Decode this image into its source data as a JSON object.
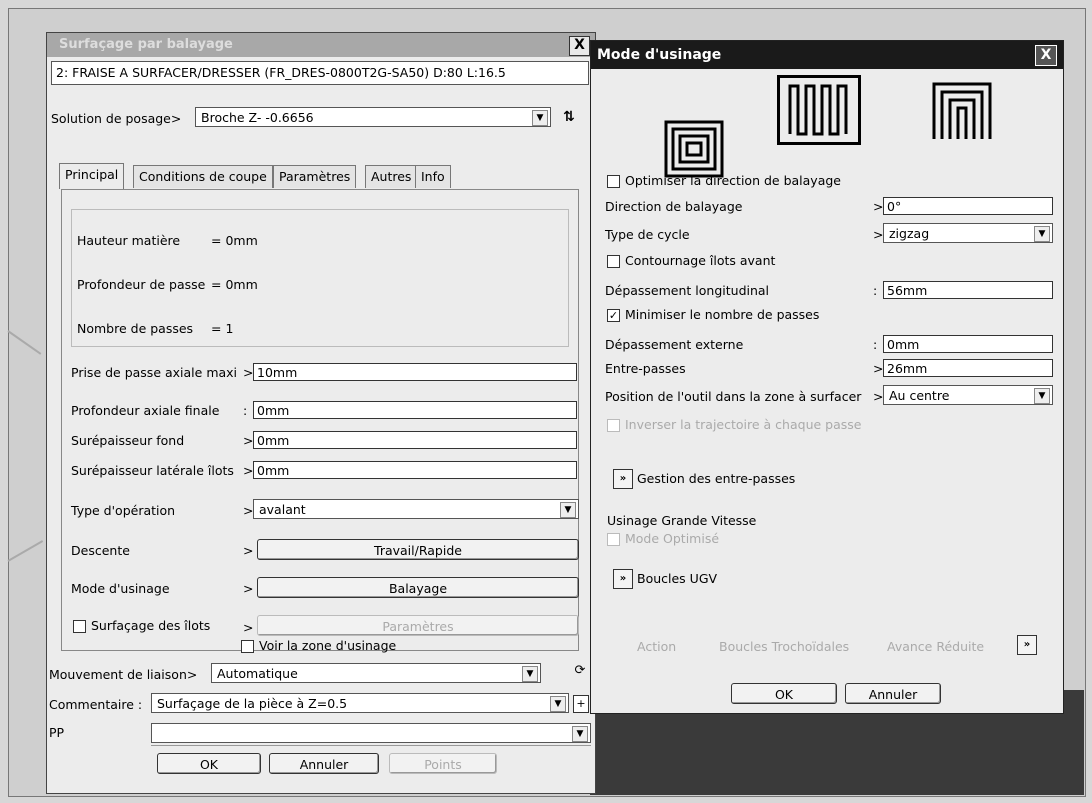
{
  "background": {
    "frame_color": "#cfcfcf",
    "dark_area_color": "#3a3a3a"
  },
  "left_dialog": {
    "title": "Surfaçage par balayage",
    "close_label": "X",
    "tool": "2: FRAISE A SURFACER/DRESSER (FR_DRES-0800T2G-SA50)  D:80  L:16.5",
    "posage_label": "Solution de posage>",
    "posage_value": "Broche Z-  -0.6656",
    "tabs": [
      "Principal",
      "Conditions de coupe",
      "Paramètres",
      "Autres",
      "Info"
    ],
    "info": [
      {
        "label": "Hauteur matière",
        "value": "= 0mm"
      },
      {
        "label": "Profondeur de passe",
        "value": "= 0mm"
      },
      {
        "label": "Nombre de passes",
        "value": "= 1"
      }
    ],
    "params": [
      {
        "label": "Prise de passe axiale maxi",
        "sep": ">",
        "value": "10mm"
      },
      {
        "label": "Profondeur axiale finale",
        "sep": ":",
        "value": "0mm"
      },
      {
        "label": "Surépaisseur fond",
        "sep": ">",
        "value": "0mm"
      },
      {
        "label": "Surépaisseur latérale îlots",
        "sep": ">",
        "value": "0mm"
      }
    ],
    "type_operation": {
      "label": "Type d'opération",
      "sep": ">",
      "value": "avalant"
    },
    "descente": {
      "label": "Descente",
      "sep": ">",
      "button": "Travail/Rapide"
    },
    "mode_usinage": {
      "label": "Mode d'usinage",
      "sep": ">",
      "button": "Balayage"
    },
    "surfacage_ilots": {
      "label": "Surfaçage des îlots",
      "sep": ">",
      "button": "Paramètres"
    },
    "voir_zone": "Voir la zone d'usinage",
    "mouvement": {
      "label": "Mouvement de liaison>",
      "value": "Automatique"
    },
    "commentaire": {
      "label": "Commentaire :",
      "value": "Surfaçage de la pièce à Z=0.5"
    },
    "pp": {
      "label": "PP",
      "value": ""
    },
    "buttons": {
      "ok": "OK",
      "cancel": "Annuler",
      "points": "Points"
    }
  },
  "right_dialog": {
    "title": "Mode d'usinage",
    "close_label": "X",
    "optimiser": {
      "label": "Optimiser la direction de balayage",
      "checked": false
    },
    "direction": {
      "label": "Direction de balayage",
      "sep": ">",
      "value": "0°"
    },
    "type_cycle": {
      "label": "Type de cycle",
      "sep": ">",
      "value": "zigzag"
    },
    "contournage": {
      "label": "Contournage îlots avant",
      "checked": false
    },
    "depassement_long": {
      "label": "Dépassement longitudinal",
      "sep": ":",
      "value": "56mm"
    },
    "minimiser": {
      "label": "Minimiser le nombre de passes",
      "checked": true
    },
    "depassement_ext": {
      "label": "Dépassement externe",
      "sep": ":",
      "value": "0mm"
    },
    "entre_passes": {
      "label": "Entre-passes",
      "sep": ">",
      "value": "26mm"
    },
    "position_outil": {
      "label": "Position de l'outil dans la zone à surfacer",
      "sep": ">",
      "value": "Au centre"
    },
    "inverser": {
      "label": "Inverser la trajectoire à chaque passe"
    },
    "gestion": "Gestion des entre-passes",
    "ugv_title": "Usinage Grande Vitesse",
    "mode_optimise": "Mode Optimisé",
    "boucles": "Boucles UGV",
    "bottom_links": [
      "Action",
      "Boucles Trochoïdales",
      "Avance Réduite"
    ],
    "buttons": {
      "ok": "OK",
      "cancel": "Annuler"
    }
  }
}
